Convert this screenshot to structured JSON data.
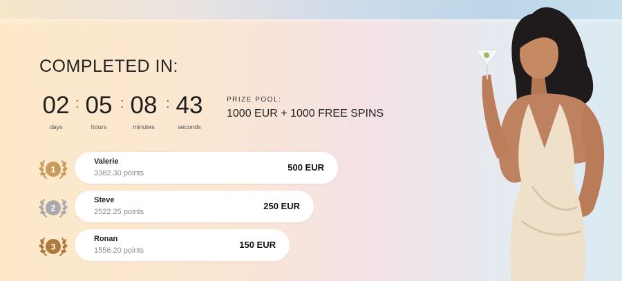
{
  "countdown": {
    "title": "COMPLETED IN:",
    "units": [
      {
        "value": "02",
        "label": "days"
      },
      {
        "value": "05",
        "label": "hours"
      },
      {
        "value": "08",
        "label": "minutes"
      },
      {
        "value": "43",
        "label": "seconds"
      }
    ],
    "separator": ":"
  },
  "prize_pool": {
    "label": "PRIZE POOL:",
    "value": "1000 EUR + 1000 FREE SPINS"
  },
  "leaderboard": [
    {
      "rank": "1",
      "name": "Valerie",
      "points": "3382.30 points",
      "prize": "500 EUR",
      "medal": "gold-laurel-icon",
      "color": "#c99a5b"
    },
    {
      "rank": "2",
      "name": "Steve",
      "points": "2522.25 points",
      "prize": "250 EUR",
      "medal": "silver-laurel-icon",
      "color": "#a9a9ad"
    },
    {
      "rank": "3",
      "name": "Ronan",
      "points": "1556.20 points",
      "prize": "150 EUR",
      "medal": "bronze-laurel-icon",
      "color": "#b07a3e"
    }
  ],
  "colors": {
    "gold": "#c99a5b",
    "silver": "#a9a9ad",
    "bronze": "#b07a3e",
    "card": "#ffffff"
  }
}
